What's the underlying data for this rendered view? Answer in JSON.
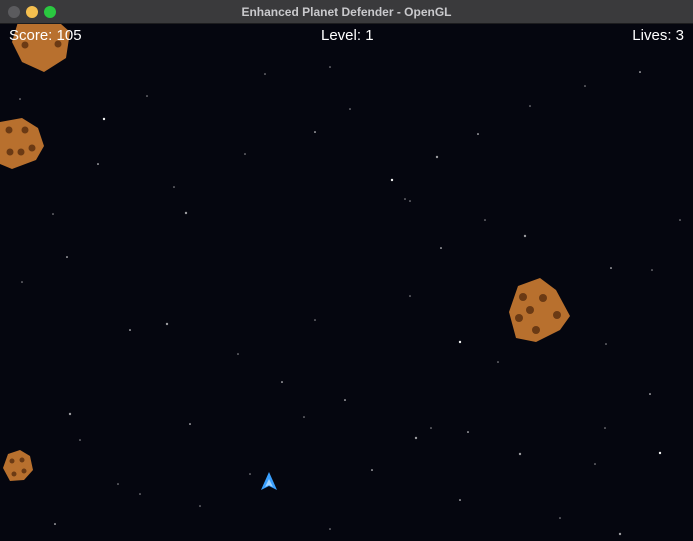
{
  "window": {
    "title": "Enhanced Planet Defender - OpenGL"
  },
  "hud": {
    "score": "Score: 105",
    "level": "Level: 1",
    "lives": "Lives: 3"
  },
  "colors": {
    "background": "#05060f",
    "asteroid": "#b8702e",
    "crater": "#6b3a14",
    "ship": "#3aa0ff",
    "star": "#ffffff"
  },
  "icons": [
    "close-button-icon",
    "minimize-button-icon",
    "maximize-button-icon",
    "player-ship-icon",
    "asteroid-icon",
    "star-icon"
  ]
}
